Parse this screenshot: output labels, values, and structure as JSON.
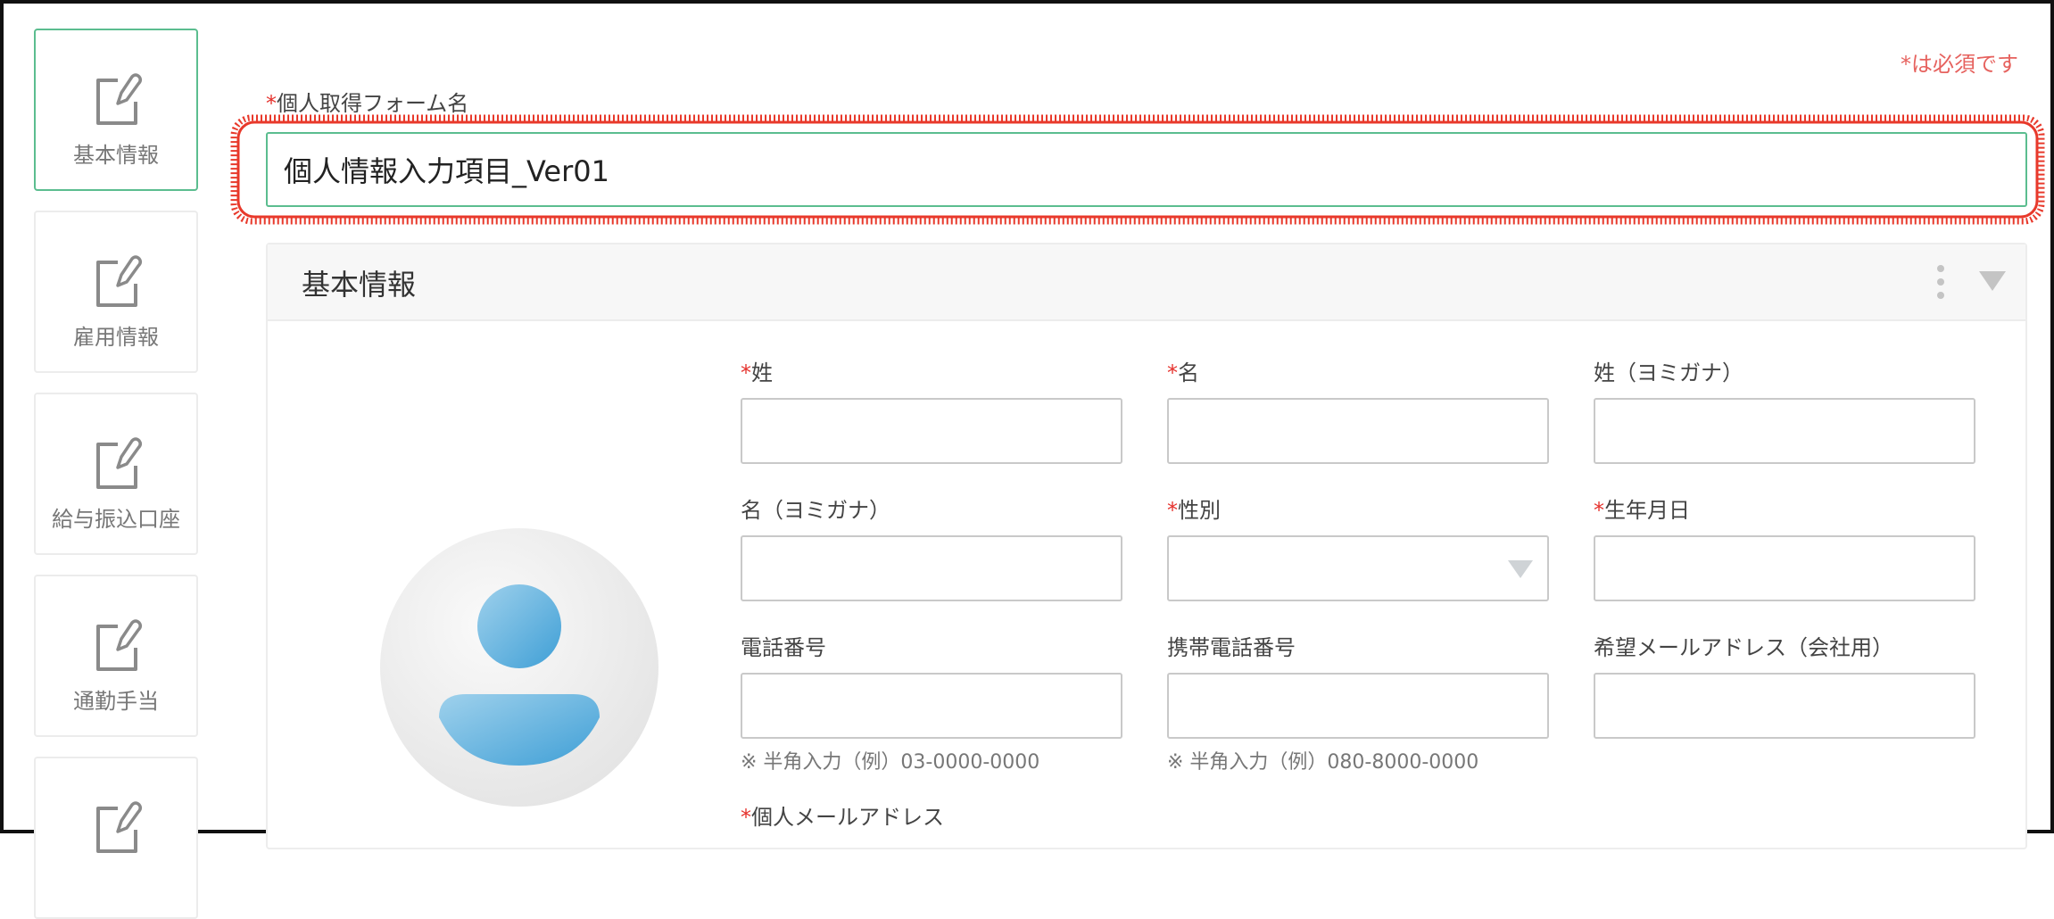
{
  "nav": {
    "items": [
      {
        "label": "基本情報",
        "icon": "edit-note-icon",
        "active": true
      },
      {
        "label": "雇用情報",
        "icon": "edit-note-icon",
        "active": false
      },
      {
        "label": "給与振込口座",
        "icon": "edit-note-icon",
        "active": false
      },
      {
        "label": "通勤手当",
        "icon": "edit-note-icon",
        "active": false
      },
      {
        "label": "",
        "icon": "edit-note-icon",
        "active": false
      }
    ]
  },
  "form": {
    "required_note": "*は必須です",
    "required_mark": "*",
    "name_field": {
      "label": "個人取得フォーム名",
      "value": "個人情報入力項目_Ver01"
    }
  },
  "section": {
    "title": "基本情報",
    "fields": {
      "last_name": {
        "label": "姓",
        "value": ""
      },
      "first_name": {
        "label": "名",
        "value": ""
      },
      "last_name_kana": {
        "label": "姓（ヨミガナ）",
        "value": ""
      },
      "first_name_kana": {
        "label": "名（ヨミガナ）",
        "value": ""
      },
      "gender": {
        "label": "性別",
        "value": ""
      },
      "birthdate": {
        "label": "生年月日",
        "value": ""
      },
      "phone": {
        "label": "電話番号",
        "value": "",
        "hint": "※ 半角入力（例）03-0000-0000"
      },
      "mobile": {
        "label": "携帯電話番号",
        "value": "",
        "hint": "※ 半角入力（例）080-8000-0000"
      },
      "work_email": {
        "label": "希望メールアドレス（会社用）",
        "value": ""
      },
      "personal_email": {
        "label": "個人メールアドレス"
      }
    }
  },
  "colors": {
    "accent": "#5bbd8f",
    "required": "#e5322d",
    "highlight": "#e8392b",
    "avatar": "#5aaedb"
  }
}
